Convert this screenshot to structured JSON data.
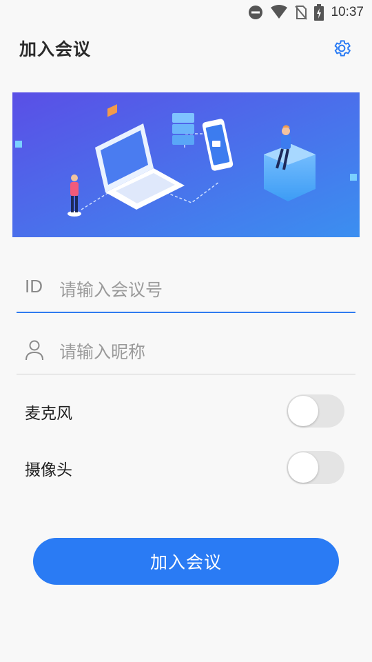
{
  "status_bar": {
    "time": "10:37",
    "icons": [
      "do-not-disturb-icon",
      "wifi-icon",
      "no-sim-icon",
      "battery-charging-icon"
    ]
  },
  "header": {
    "title": "加入会议",
    "settings_icon": "gear-icon"
  },
  "banner": {
    "illustration": "video-conference-illustration"
  },
  "form": {
    "meeting_id": {
      "prefix": "ID",
      "placeholder": "请输入会议号",
      "value": ""
    },
    "nickname": {
      "icon": "person-icon",
      "placeholder": "请输入昵称",
      "value": ""
    }
  },
  "toggles": {
    "microphone": {
      "label": "麦克风",
      "on": false
    },
    "camera": {
      "label": "摄像头",
      "on": false
    }
  },
  "join_button": {
    "label": "加入会议"
  },
  "colors": {
    "accent": "#2a7bf4",
    "background": "#f8f8f8",
    "toggle_off": "#e4e4e4"
  }
}
